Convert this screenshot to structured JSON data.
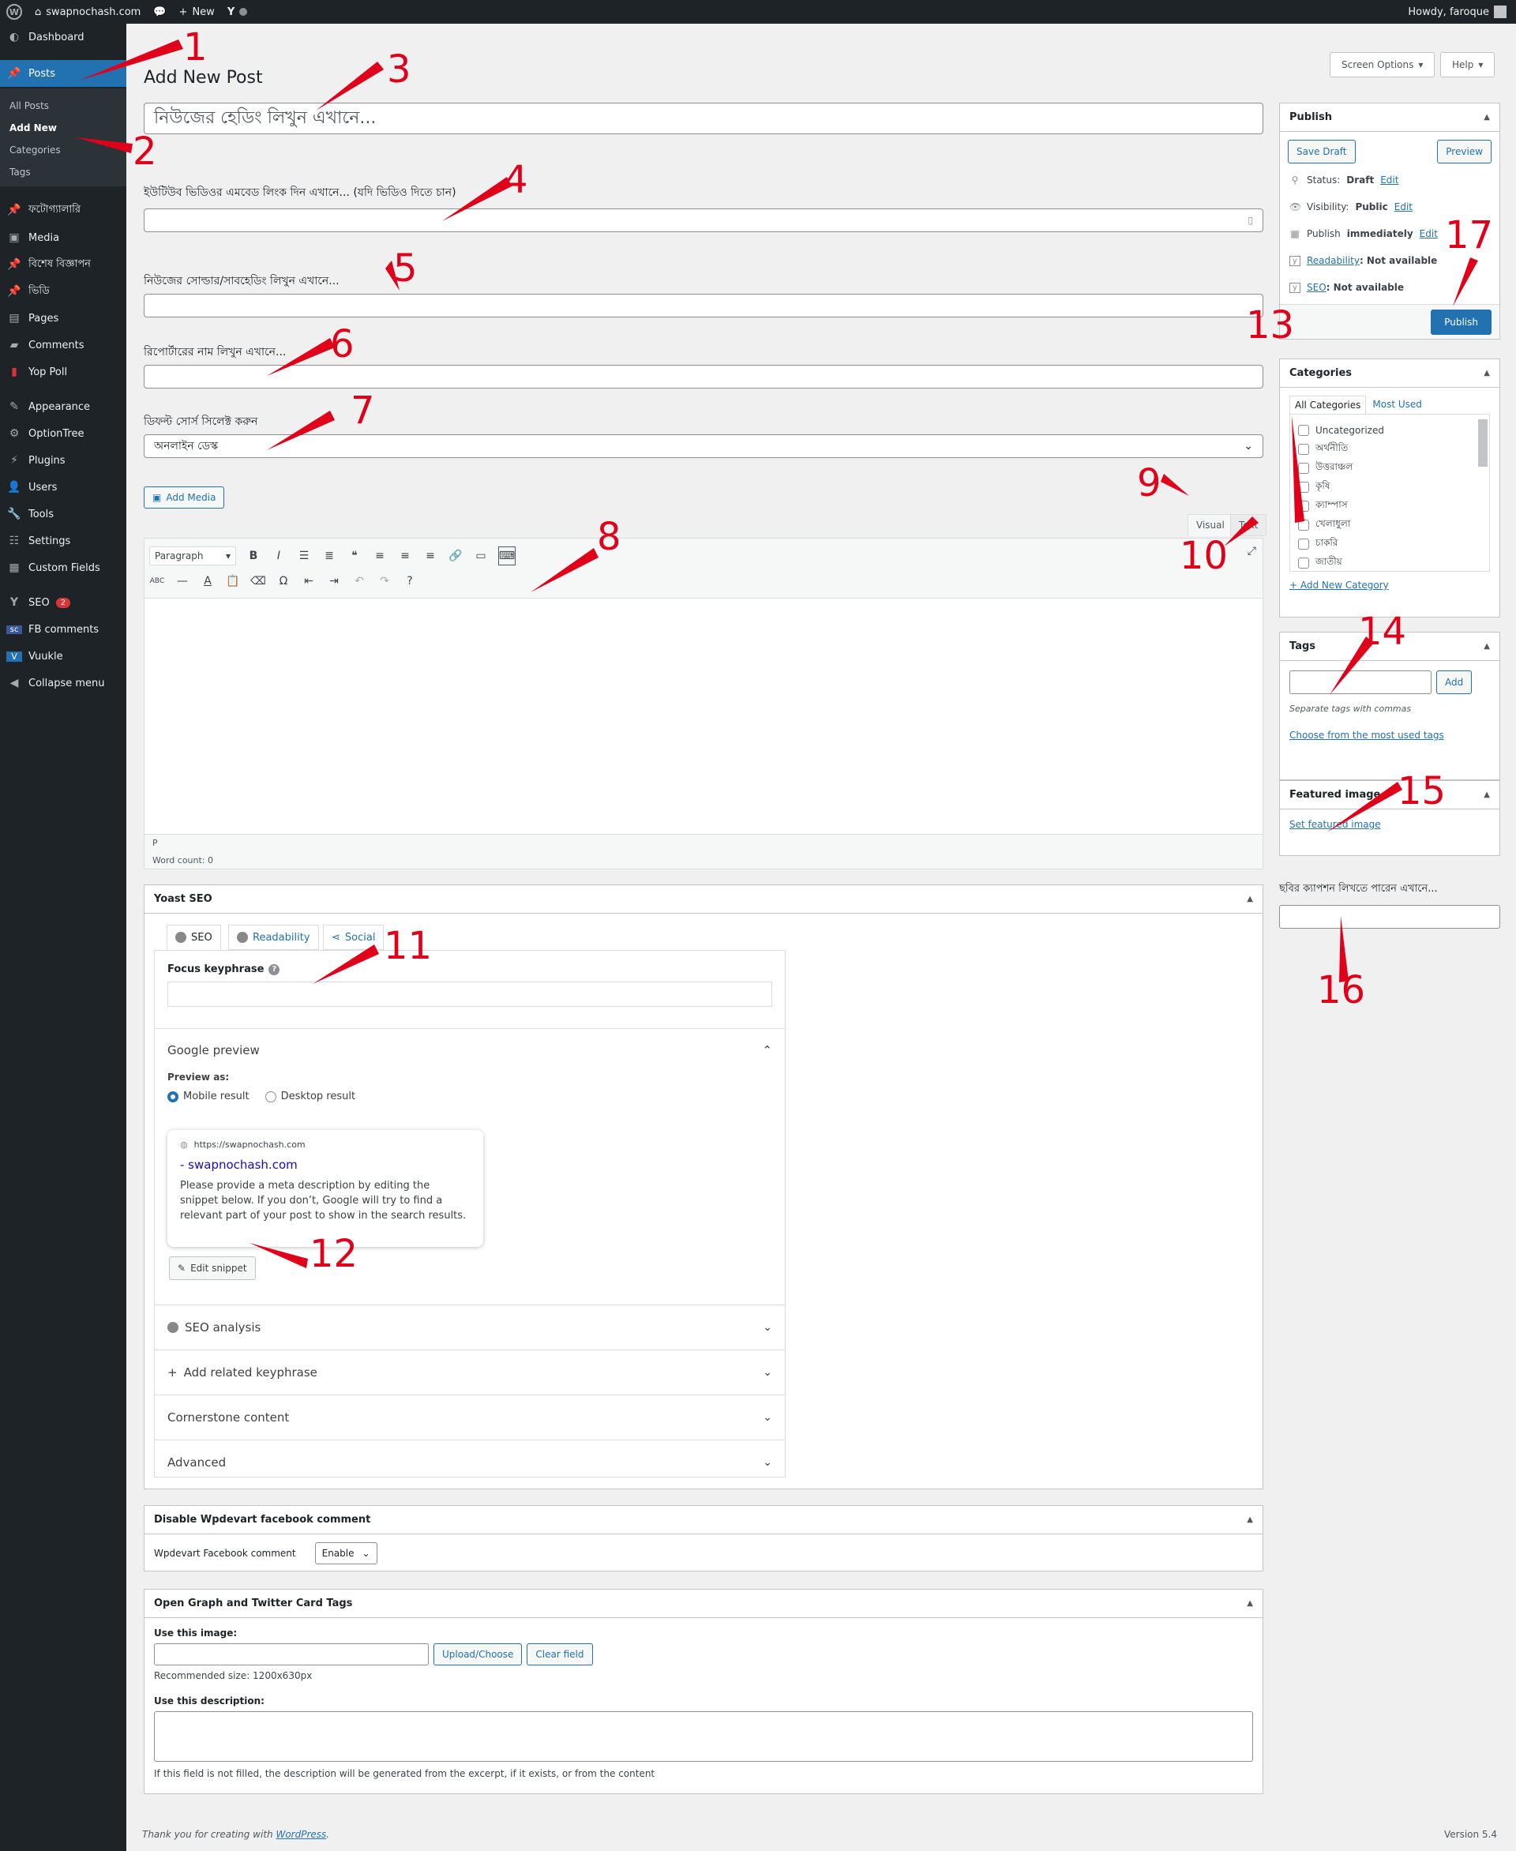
{
  "adminbar": {
    "site_name": "swapnochash.com",
    "comments_count": "",
    "new_label": "New",
    "howdy": "Howdy, faroque"
  },
  "sidebar": {
    "items": [
      {
        "label": "Dashboard",
        "icon": "dashboard-icon"
      },
      {
        "label": "Posts",
        "icon": "pin-icon"
      },
      {
        "label": "ফটোগ্যালারি",
        "icon": "pin-icon"
      },
      {
        "label": "Media",
        "icon": "media-icon"
      },
      {
        "label": "বিশেষ বিজ্ঞাপন",
        "icon": "pin-icon"
      },
      {
        "label": "ভিডি",
        "icon": "pin-icon"
      },
      {
        "label": "Pages",
        "icon": "pages-icon"
      },
      {
        "label": "Comments",
        "icon": "comment-icon"
      },
      {
        "label": "Yop Poll",
        "icon": "poll-icon"
      },
      {
        "label": "Appearance",
        "icon": "brush-icon"
      },
      {
        "label": "OptionTree",
        "icon": "gear-icon"
      },
      {
        "label": "Plugins",
        "icon": "plug-icon"
      },
      {
        "label": "Users",
        "icon": "user-icon"
      },
      {
        "label": "Tools",
        "icon": "wrench-icon"
      },
      {
        "label": "Settings",
        "icon": "settings-icon"
      },
      {
        "label": "Custom Fields",
        "icon": "grid-icon"
      },
      {
        "label": "SEO",
        "icon": "yoast-icon",
        "badge": "2"
      },
      {
        "label": "FB comments",
        "icon": "fb-icon"
      },
      {
        "label": "Vuukle",
        "icon": "v-icon"
      },
      {
        "label": "Collapse menu",
        "icon": "collapse-icon"
      }
    ],
    "posts_sub": [
      "All Posts",
      "Add New",
      "Categories",
      "Tags"
    ]
  },
  "header": {
    "page_title": "Add New Post",
    "screen_options": "Screen Options",
    "help": "Help"
  },
  "form": {
    "title_placeholder": "নিউজের হেডিং লিখুন এখানে...",
    "youtube_label": "ইউটিউব ভিডিওর এমবেড লিংক দিন এখানে... (যদি ভিডিও দিতে চান)",
    "subheading_label": "নিউজের সোল্ডার/সাবহেডিং লিখুন এখানে...",
    "reporter_label": "রিপোর্টারের নাম লিখুন এখানে...",
    "source_label": "ডিফল্ট সোর্স সিলেক্ট করুন",
    "source_value": "অনলাইন ডেস্ক"
  },
  "editor": {
    "add_media": "Add Media",
    "tab_visual": "Visual",
    "tab_text": "Text",
    "paragraph": "Paragraph",
    "path": "P",
    "word_count": "Word count: 0"
  },
  "yoast": {
    "title": "Yoast SEO",
    "tabs": [
      "SEO",
      "Readability",
      "Social"
    ],
    "focus_label": "Focus keyphrase",
    "google_preview": "Google preview",
    "preview_as": "Preview as:",
    "mobile": "Mobile result",
    "desktop": "Desktop result",
    "snippet_url": "https://swapnochash.com",
    "snippet_title": "- swapnochash.com",
    "snippet_desc": "Please provide a meta description by editing the snippet below. If you don’t, Google will try to find a relevant part of your post to show in the search results.",
    "edit_snippet": "Edit snippet",
    "rows": [
      "SEO analysis",
      "Add related keyphrase",
      "Cornerstone content",
      "Advanced"
    ]
  },
  "fbbox": {
    "title": "Disable Wpdevart facebook comment",
    "label": "Wpdevart Facebook comment",
    "value": "Enable"
  },
  "ogbox": {
    "title": "Open Graph and Twitter Card Tags",
    "use_image": "Use this image:",
    "upload": "Upload/Choose",
    "clear": "Clear field",
    "recommended": "Recommended size: 1200x630px",
    "use_desc": "Use this description:",
    "note": "If this field is not filled, the description will be generated from the excerpt, if it exists, or from the content"
  },
  "publish": {
    "title": "Publish",
    "save_draft": "Save Draft",
    "preview": "Preview",
    "status_label": "Status:",
    "status_value": "Draft",
    "visibility_label": "Visibility:",
    "visibility_value": "Public",
    "publish_label": "Publish",
    "publish_value": "immediately",
    "edit": "Edit",
    "readability_link": "Readability",
    "readability_value": ": Not available",
    "seo_link": "SEO",
    "seo_value": ": Not available",
    "publish_button": "Publish"
  },
  "categories": {
    "title": "Categories",
    "tab_all": "All Categories",
    "tab_used": "Most Used",
    "items": [
      "Uncategorized",
      "অর্থনীতি",
      "উত্তরাঞ্চল",
      "কৃষি",
      "ক্যাম্পাস",
      "খেলাধুলা",
      "চাকরি",
      "জাতীয়"
    ],
    "add_new": "+ Add New Category"
  },
  "tags": {
    "title": "Tags",
    "add": "Add",
    "hint": "Separate tags with commas",
    "choose": "Choose from the most used tags"
  },
  "featured": {
    "title": "Featured image",
    "set": "Set featured image"
  },
  "caption": {
    "label": "ছবির ক্যাপশন লিখতে পারেন এখানে..."
  },
  "annotations": [
    "1",
    "2",
    "3",
    "4",
    "5",
    "6",
    "7",
    "8",
    "9",
    "10",
    "11",
    "12",
    "13",
    "14",
    "15",
    "16",
    "17"
  ],
  "footer": {
    "thanks": "Thank you for creating with ",
    "wp_link": "WordPress",
    "thanks_end": ".",
    "version": "Version 5.4"
  },
  "colors": {
    "accent": "#2271b1",
    "admin_dark": "#1d2327",
    "annotation": "#e0001a"
  }
}
